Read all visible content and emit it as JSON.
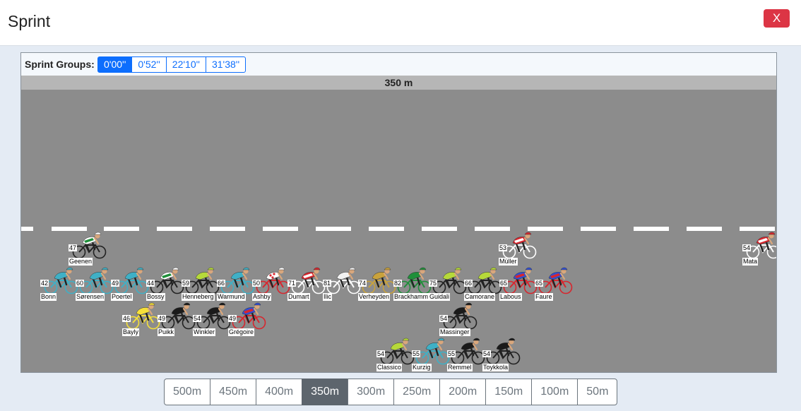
{
  "title": "Sprint",
  "close_label": "X",
  "groups_label": "Sprint Groups:",
  "groups": [
    "0'00''",
    "0'52''",
    "22'10''",
    "31'38''"
  ],
  "active_group": 0,
  "distance_label": "350 m",
  "distances": [
    "500m",
    "450m",
    "400m",
    "350m",
    "300m",
    "250m",
    "200m",
    "150m",
    "100m",
    "50m"
  ],
  "active_distance": 3,
  "jersey_colors": {
    "white-green": "#ffffff",
    "teal": "#3fb0c6",
    "lime": "#b6d93a",
    "polka": "#ffffff",
    "red-white": "#d8262e",
    "white": "#f2f2f2",
    "gold": "#c9a23c",
    "green": "#1f8f3a",
    "blue-red": "#2f4fd6",
    "yellow": "#f5e03a",
    "black": "#1a1a1a"
  },
  "riders": [
    {
      "num": "47",
      "name": "Geenen",
      "jersey": "white-green",
      "bike": "#222222"
    },
    {
      "num": "53",
      "name": "Müller",
      "jersey": "red-white",
      "bike": "#ffffff"
    },
    {
      "num": "54",
      "name": "Mata",
      "jersey": "red-white",
      "bike": "#ffffff"
    },
    {
      "num": "42",
      "name": "Bonn",
      "jersey": "teal",
      "bike": "#3fb0c6"
    },
    {
      "num": "60",
      "name": "Sørensen",
      "jersey": "teal",
      "bike": "#3fb0c6"
    },
    {
      "num": "49",
      "name": "Poertel",
      "jersey": "teal",
      "bike": "#3fb0c6"
    },
    {
      "num": "44",
      "name": "Bossy",
      "jersey": "white-green",
      "bike": "#222222"
    },
    {
      "num": "59",
      "name": "Henneberg",
      "jersey": "lime",
      "bike": "#222222"
    },
    {
      "num": "66",
      "name": "Warmund",
      "jersey": "teal",
      "bike": "#3fb0c6"
    },
    {
      "num": "50",
      "name": "Ashby",
      "jersey": "polka",
      "bike": "#d8262e"
    },
    {
      "num": "71",
      "name": "Dumart",
      "jersey": "red-white",
      "bike": "#ffffff"
    },
    {
      "num": "81",
      "name": "Ilic",
      "jersey": "white",
      "bike": "#ffffff"
    },
    {
      "num": "74",
      "name": "Verheyden",
      "jersey": "gold",
      "bike": "#c9a23c"
    },
    {
      "num": "82",
      "name": "Brackhamm",
      "jersey": "green",
      "bike": "#1f8f3a"
    },
    {
      "num": "75",
      "name": "Guidali",
      "jersey": "lime",
      "bike": "#222222"
    },
    {
      "num": "66",
      "name": "Camorane",
      "jersey": "lime",
      "bike": "#222222"
    },
    {
      "num": "65",
      "name": "Labous",
      "jersey": "blue-red",
      "bike": "#d8262e"
    },
    {
      "num": "65",
      "name": "Faure",
      "jersey": "blue-red",
      "bike": "#d8262e"
    },
    {
      "num": "46",
      "name": "Bayly",
      "jersey": "yellow",
      "bike": "#f5e03a"
    },
    {
      "num": "49",
      "name": "Puikk",
      "jersey": "black",
      "bike": "#222222"
    },
    {
      "num": "54",
      "name": "Winkler",
      "jersey": "black",
      "bike": "#222222"
    },
    {
      "num": "49",
      "name": "Grégoire",
      "jersey": "blue-red",
      "bike": "#d8262e"
    },
    {
      "num": "54",
      "name": "Massinger",
      "jersey": "black",
      "bike": "#222222"
    },
    {
      "num": "54",
      "name": "Classico",
      "jersey": "lime",
      "bike": "#222222"
    },
    {
      "num": "55",
      "name": "Kurzig",
      "jersey": "teal",
      "bike": "#3fb0c6"
    },
    {
      "num": "55",
      "name": "Remmel",
      "jersey": "black",
      "bike": "#222222"
    },
    {
      "num": "54",
      "name": "Toykkola",
      "jersey": "black",
      "bike": "#222222"
    }
  ]
}
